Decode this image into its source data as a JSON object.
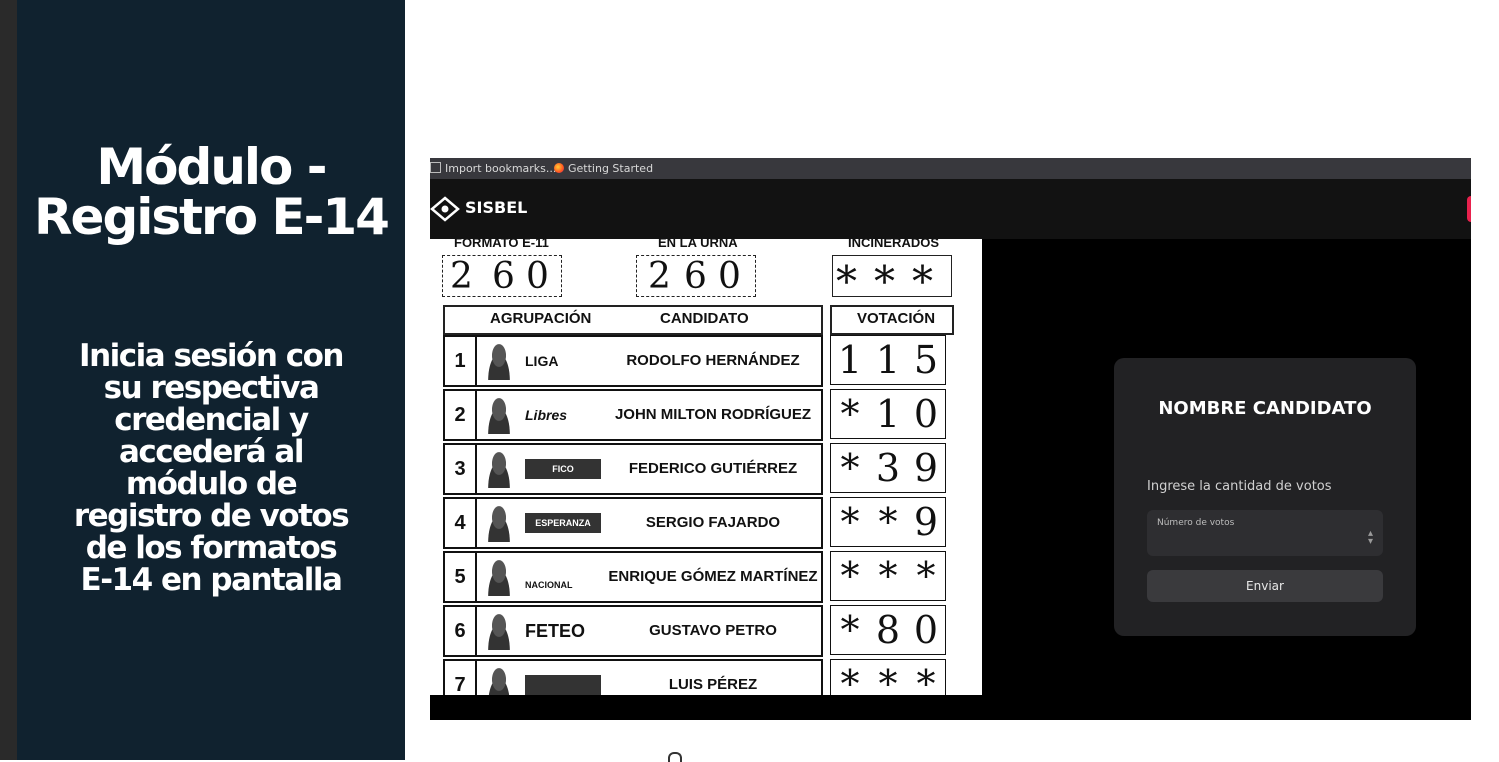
{
  "slide": {
    "title_line1": "Módulo -",
    "title_line2": "Registro E-14",
    "description": "Inicia sesión con su respectiva credencial y accederá al módulo de registro de votos de los formatos E-14 en pantalla"
  },
  "browser": {
    "bookmarks": [
      {
        "label": "Import bookmarks...",
        "icon": "import-icon"
      },
      {
        "label": "Getting Started",
        "icon": "firefox-icon"
      }
    ]
  },
  "app": {
    "brand": "SISBEL",
    "logo_icon": "sisbel-logo-icon"
  },
  "form": {
    "headers": {
      "formato": "FORMATO E-11",
      "urna": "EN LA URNA",
      "incinerados": "INCINERADOS"
    },
    "formato_digits": [
      "2",
      "6",
      "0"
    ],
    "urna_digits": [
      "2",
      "6",
      "0"
    ],
    "incinerados_marks": [
      "*",
      "*",
      "*"
    ],
    "table_headers": {
      "agrupacion": "AGRUPACIÓN",
      "candidato": "CANDIDATO",
      "votacion": "VOTACIÓN"
    },
    "rows": [
      {
        "num": "1",
        "party": "LIGA",
        "candidate": "RODOLFO HERNÁNDEZ",
        "votes": [
          "1",
          "1",
          "5"
        ]
      },
      {
        "num": "2",
        "party": "Libres",
        "candidate": "JOHN MILTON RODRÍGUEZ",
        "votes": [
          "*",
          "1",
          "0"
        ]
      },
      {
        "num": "3",
        "party": "FICO",
        "candidate": "FEDERICO GUTIÉRREZ",
        "votes": [
          "*",
          "3",
          "9"
        ]
      },
      {
        "num": "4",
        "party": "ESPERANZA",
        "candidate": "SERGIO FAJARDO",
        "votes": [
          "*",
          "*",
          "9"
        ]
      },
      {
        "num": "5",
        "party": "NACIONAL",
        "candidate": "ENRIQUE GÓMEZ MARTÍNEZ",
        "votes": [
          "*",
          "*",
          "*"
        ]
      },
      {
        "num": "6",
        "party": "FETEO",
        "candidate": "GUSTAVO PETRO",
        "votes": [
          "*",
          "8",
          "0"
        ]
      },
      {
        "num": "7",
        "party": "",
        "candidate": "LUIS PÉREZ",
        "votes": [
          "*",
          "*",
          "*"
        ]
      }
    ]
  },
  "modal": {
    "title": "NOMBRE CANDIDATO",
    "label": "Ingrese la cantidad de votos",
    "input_placeholder": "Número de votos",
    "submit_label": "Enviar"
  },
  "colors": {
    "panel_bg": "#10222f",
    "app_bar": "#121212",
    "card_bg": "#222224",
    "accent_red": "#e8214d"
  }
}
